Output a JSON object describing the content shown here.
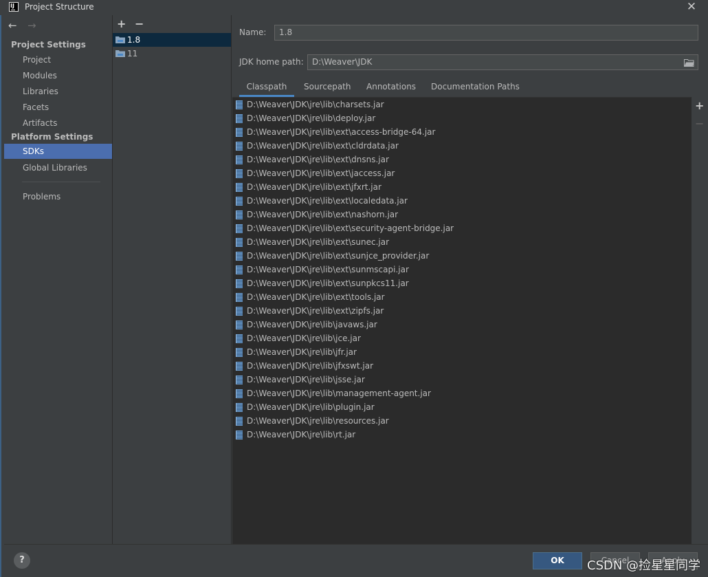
{
  "window": {
    "title": "Project Structure",
    "close_glyph": "✕"
  },
  "nav": {
    "back_glyph": "←",
    "forward_glyph": "→",
    "project_settings_header": "Project Settings",
    "project_settings_items": [
      "Project",
      "Modules",
      "Libraries",
      "Facets",
      "Artifacts"
    ],
    "platform_settings_header": "Platform Settings",
    "platform_settings_items": [
      "SDKs",
      "Global Libraries"
    ],
    "selected_item": "SDKs",
    "problems_label": "Problems"
  },
  "sdk_list": {
    "add_glyph": "+",
    "remove_glyph": "−",
    "items": [
      {
        "label": "1.8",
        "selected": true
      },
      {
        "label": "11",
        "selected": false
      }
    ]
  },
  "sdk_details": {
    "name_label": "Name:",
    "name_value": "1.8",
    "jdk_home_label": "JDK home path:",
    "jdk_home_value": "D:\\Weaver\\JDK",
    "tabs": [
      "Classpath",
      "Sourcepath",
      "Annotations",
      "Documentation Paths"
    ],
    "active_tab": "Classpath",
    "add_path_glyph": "+",
    "remove_path_glyph": "−",
    "classpath": [
      "D:\\Weaver\\JDK\\jre\\lib\\charsets.jar",
      "D:\\Weaver\\JDK\\jre\\lib\\deploy.jar",
      "D:\\Weaver\\JDK\\jre\\lib\\ext\\access-bridge-64.jar",
      "D:\\Weaver\\JDK\\jre\\lib\\ext\\cldrdata.jar",
      "D:\\Weaver\\JDK\\jre\\lib\\ext\\dnsns.jar",
      "D:\\Weaver\\JDK\\jre\\lib\\ext\\jaccess.jar",
      "D:\\Weaver\\JDK\\jre\\lib\\ext\\jfxrt.jar",
      "D:\\Weaver\\JDK\\jre\\lib\\ext\\localedata.jar",
      "D:\\Weaver\\JDK\\jre\\lib\\ext\\nashorn.jar",
      "D:\\Weaver\\JDK\\jre\\lib\\ext\\security-agent-bridge.jar",
      "D:\\Weaver\\JDK\\jre\\lib\\ext\\sunec.jar",
      "D:\\Weaver\\JDK\\jre\\lib\\ext\\sunjce_provider.jar",
      "D:\\Weaver\\JDK\\jre\\lib\\ext\\sunmscapi.jar",
      "D:\\Weaver\\JDK\\jre\\lib\\ext\\sunpkcs11.jar",
      "D:\\Weaver\\JDK\\jre\\lib\\ext\\tools.jar",
      "D:\\Weaver\\JDK\\jre\\lib\\ext\\zipfs.jar",
      "D:\\Weaver\\JDK\\jre\\lib\\javaws.jar",
      "D:\\Weaver\\JDK\\jre\\lib\\jce.jar",
      "D:\\Weaver\\JDK\\jre\\lib\\jfr.jar",
      "D:\\Weaver\\JDK\\jre\\lib\\jfxswt.jar",
      "D:\\Weaver\\JDK\\jre\\lib\\jsse.jar",
      "D:\\Weaver\\JDK\\jre\\lib\\management-agent.jar",
      "D:\\Weaver\\JDK\\jre\\lib\\plugin.jar",
      "D:\\Weaver\\JDK\\jre\\lib\\resources.jar",
      "D:\\Weaver\\JDK\\jre\\lib\\rt.jar"
    ]
  },
  "footer": {
    "help_glyph": "?",
    "ok_label": "OK",
    "cancel_label": "Cancel",
    "apply_label": "Apply",
    "watermark": "CSDN @捡星星同学"
  },
  "colors": {
    "background": "#3c3f41",
    "selection": "#4b6eaf",
    "list_selection": "#0d293e",
    "tab_underline": "#4a88c7",
    "ok_button": "#365880"
  }
}
